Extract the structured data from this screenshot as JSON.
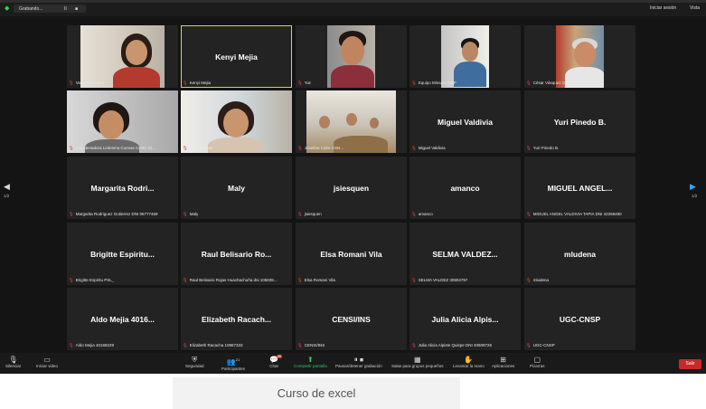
{
  "topbar": {
    "tab_title": "Grabando...",
    "tab_pause": "II",
    "tab_stop": "■",
    "login": "Iniciar sesión",
    "view": "Vista"
  },
  "tiles": [
    {
      "id": "t1",
      "display": "",
      "label": "Vanessa Eniére",
      "video": "woman1"
    },
    {
      "id": "t2",
      "display": "Kenyi Mejia",
      "label": "Kenyi Mejia",
      "active": true
    },
    {
      "id": "t3",
      "display": "",
      "label": "Yuri",
      "video": "man1"
    },
    {
      "id": "t4",
      "display": "",
      "label": "Equipo Minsal CNSP",
      "video": "boy"
    },
    {
      "id": "t5",
      "display": "",
      "label": "César Vásquez Castillo",
      "video": "man2"
    },
    {
      "id": "t6",
      "display": "",
      "label": "Coordenadora Ledesma Cuevas Ccete 10...",
      "video": "woman2"
    },
    {
      "id": "t7",
      "display": "",
      "label": "Luz Huaman",
      "video": "woman3"
    },
    {
      "id": "t8",
      "display": "",
      "label": "Josefina Cabe CSN...",
      "video": "room"
    },
    {
      "id": "t9",
      "display": "Miguel Valdivia",
      "label": "Miguel Valdivia"
    },
    {
      "id": "t10",
      "display": "Yuri Pinedo B.",
      "label": "Yuri Pinedo B."
    },
    {
      "id": "t11",
      "display": "Margarita Rodri...",
      "label": "Margarita Rodriguez Gutierrez DNI 06777469"
    },
    {
      "id": "t12",
      "display": "Maly",
      "label": "Maly"
    },
    {
      "id": "t13",
      "display": "jsiesquen",
      "label": "jsiesquen"
    },
    {
      "id": "t14",
      "display": "amanco",
      "label": "amanco"
    },
    {
      "id": "t15",
      "display": "MIGUEL ANGEL...",
      "label": "MIGUEL ANGEL VALDIVIA TAPIA DNI 42268490"
    },
    {
      "id": "t16",
      "display": "Brigitte Espiritu...",
      "label": "Brigitte Espiritu  PSL_"
    },
    {
      "id": "t17",
      "display": "Raul Belisario Ro...",
      "label": "Raul Belisario Rojas Huachachuña dni 105838..."
    },
    {
      "id": "t18",
      "display": "Elsa Romani Vila",
      "label": "Elsa Romani Vila"
    },
    {
      "id": "t19",
      "display": "SELMA VALDEZ...",
      "label": "SELMA VALDEZ 30904797"
    },
    {
      "id": "t20",
      "display": "mludena",
      "label": "mludena"
    },
    {
      "id": "t21",
      "display": "Aldo Mejia 4016...",
      "label": "Aldo Mejia 40168229"
    },
    {
      "id": "t22",
      "display": "Elizabeth Racach...",
      "label": "Elizabeth Racacha 10867333"
    },
    {
      "id": "t23",
      "display": "CENSI/INS",
      "label": "CENSI/INS"
    },
    {
      "id": "t24",
      "display": "Julia Alicia Alpis...",
      "label": "Julia Alicia Alpiste Quispe DNI 40609726"
    },
    {
      "id": "t25",
      "display": "UGC-CNSP",
      "label": "UGC-CNSP"
    }
  ],
  "pager": {
    "left": "1/2",
    "right": "1/2"
  },
  "toolbar": {
    "mute": "Silenciar",
    "video": "Iniciar video",
    "security": "Seguridad",
    "participants": "Participantes",
    "participants_count": "21",
    "chat": "Chat",
    "chat_badge": "99",
    "share": "Compartir pantalla",
    "pause_rec": "Pausar/detener grabación",
    "breakout": "Salas para grupos pequeños",
    "raise": "Levantar la mano",
    "apps": "Aplicaciones",
    "whiteboards": "Pizarras",
    "leave": "Salir"
  },
  "caption": "Curso de excel"
}
